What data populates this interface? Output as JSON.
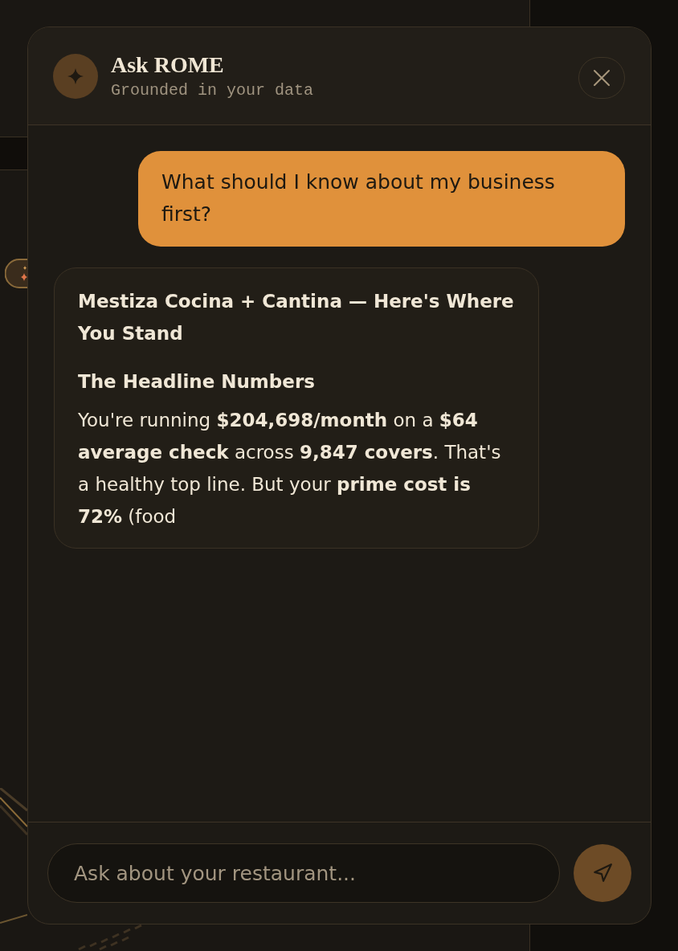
{
  "header": {
    "title": "Ask ROME",
    "subtitle": "Grounded in your data"
  },
  "messages": [
    {
      "kind": "user",
      "text": "What should I know about my business first?"
    },
    {
      "kind": "assistant",
      "blocks": [
        {
          "kind": "title",
          "text": "Mestiza Cocina + Cantina — Here's Where You Stand"
        },
        {
          "kind": "heading",
          "text": "The Headline Numbers"
        },
        {
          "kind": "paragraph",
          "text": "You're running **$204,698/month** on a **$64 average check** across **9,847 covers**. That's a healthy top line. But your **prime cost is 72%** (food"
        }
      ]
    }
  ],
  "composer": {
    "placeholder": "Ask about your restaurant..."
  }
}
